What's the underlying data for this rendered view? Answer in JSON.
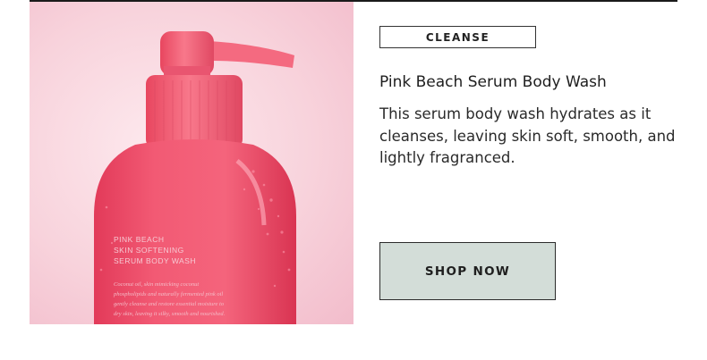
{
  "product": {
    "category_tag": "CLEANSE",
    "title": "Pink Beach Serum Body Wash",
    "description": "This serum body wash hydrates as it cleanses, leaving skin soft, smooth, and lightly fragranced.",
    "cta_label": "SHOP NOW"
  },
  "bottle_label": {
    "brand_line": "PINK BEACH",
    "line2": "SKIN SOFTENING",
    "line3": "SERUM BODY WASH",
    "fine_print": [
      "Coconut oil, skin mimicking coconut",
      "phospholipids and naturally fermented pink oil",
      "gently cleanse and restore essential moisture to",
      "dry skin, leaving it silky, smooth and nourished."
    ]
  },
  "colors": {
    "cta_background": "#d3ddd8",
    "bottle_pink": "#f0566f",
    "hero_background": "#f8d3dc"
  }
}
